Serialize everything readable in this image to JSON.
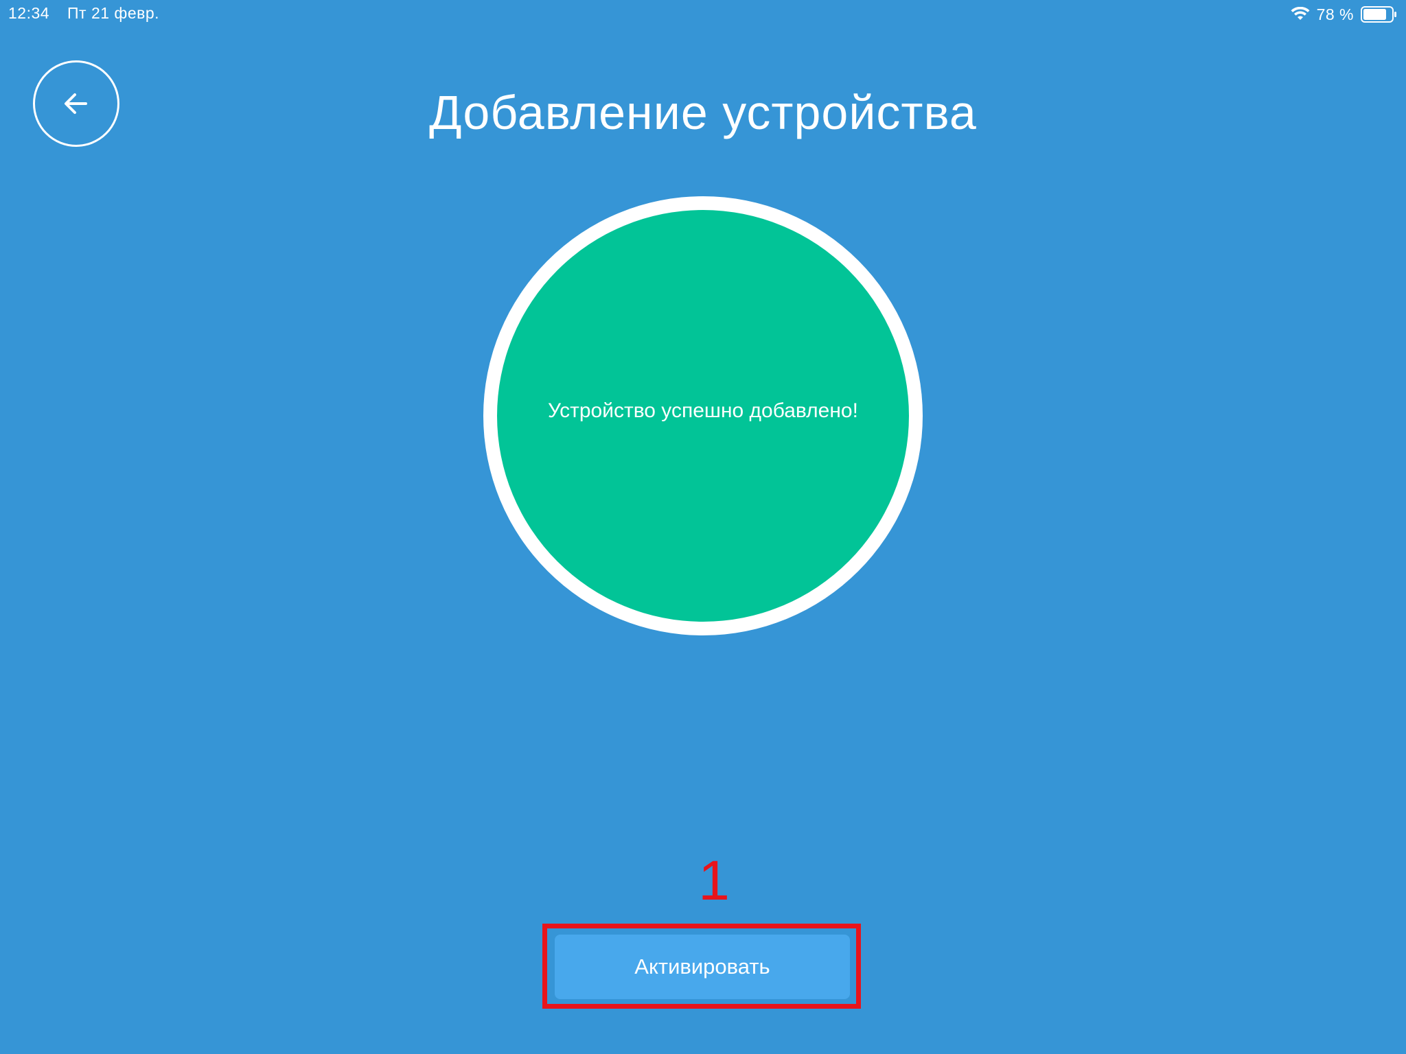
{
  "status_bar": {
    "time": "12:34",
    "date": "Пт 21 февр.",
    "battery_percent": "78 %",
    "wifi_icon": "wifi-icon",
    "battery_icon": "battery-icon"
  },
  "header": {
    "back_icon": "arrow-left-icon",
    "title": "Добавление устройства"
  },
  "main": {
    "success_message": "Устройство успешно добавлено!"
  },
  "annotation": {
    "step_number": "1"
  },
  "footer": {
    "activate_label": "Активировать"
  },
  "colors": {
    "background": "#3695d6",
    "success_green": "#02c497",
    "button_blue": "#48a8ec",
    "annotation_red": "#e8141b",
    "text": "#ffffff"
  }
}
